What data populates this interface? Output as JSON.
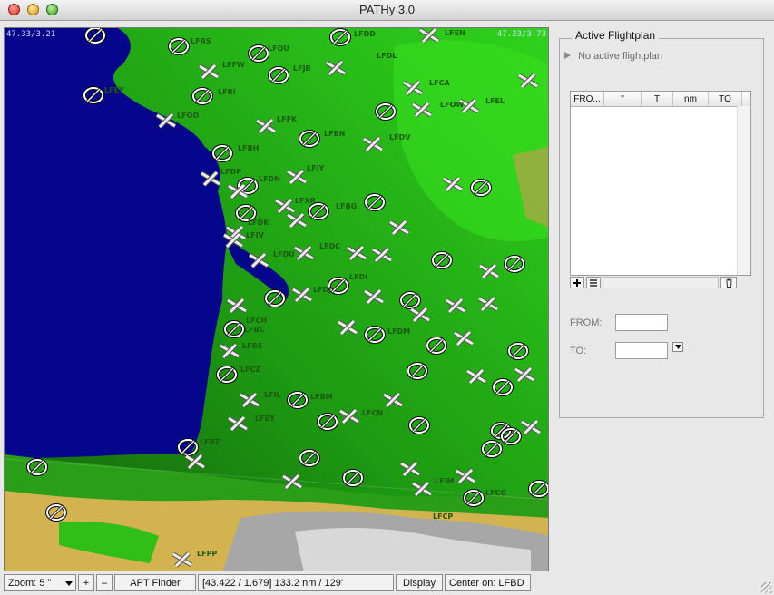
{
  "window": {
    "title": "PATHy 3.0"
  },
  "map": {
    "corner_left": "47.33/3.21",
    "corner_right": "47.33/3.73",
    "airport_codes": [
      "LFRS",
      "LFOU",
      "LFDL",
      "LFDD",
      "LFEN",
      "LFFW",
      "LFJB",
      "LFEY",
      "LFRI",
      "LFCA",
      "LFEL",
      "LFOO",
      "LFOW",
      "LFFK",
      "LFBN",
      "LFDV",
      "LFBH",
      "LFDP",
      "LFIY",
      "LFDN",
      "LFXR",
      "LFBG",
      "LFDK",
      "LFIV",
      "LFDU",
      "LFDC",
      "LFDI",
      "LFDJ",
      "LFCH",
      "LFBC",
      "LFBS",
      "LFDM",
      "LFCZ",
      "LFIL",
      "LFBM",
      "LFBY",
      "LFCN",
      "LFBZ",
      "LFIM",
      "LFCG",
      "LFCP",
      "LFPP"
    ]
  },
  "statusbar": {
    "zoom": "Zoom: 5 \"",
    "zoom_in": "+",
    "zoom_out": "–",
    "apt_finder": "APT Finder",
    "position": "[43.422 / 1.679] 133.2 nm / 129'",
    "display": "Display",
    "center": "Center on: LFBD"
  },
  "flightplan": {
    "title": "Active Flightplan",
    "status": "No active flightplan",
    "columns": [
      "FRO...",
      "\"",
      "T",
      "nm",
      "TO"
    ],
    "from_label": "FROM:",
    "to_label": "TO:",
    "from_value": "",
    "to_value": ""
  }
}
